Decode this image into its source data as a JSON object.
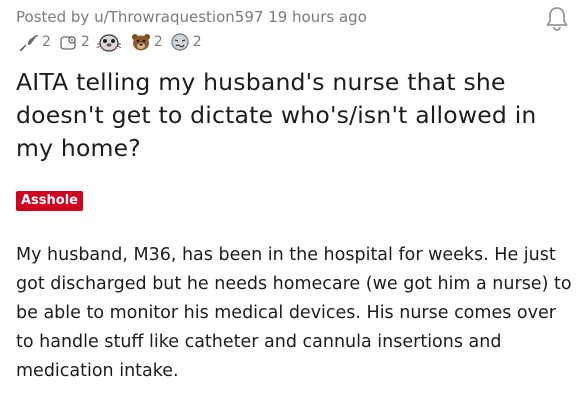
{
  "post": {
    "posted_by_prefix": "Posted by",
    "username": "u/Throwraquestion597",
    "time_ago": "19 hours ago",
    "awards": [
      {
        "icon": "rocket-icon",
        "count": "2"
      },
      {
        "icon": "toilet-paper-icon",
        "count": "2"
      },
      {
        "icon": "wholesome-seal-icon",
        "count": ""
      },
      {
        "icon": "bear-icon",
        "count": "2"
      },
      {
        "icon": "confused-face-icon",
        "count": "2"
      }
    ],
    "title": "AITA telling my husband's nurse that she doesn't get to dictate who's/isn't allowed in my home?",
    "flair": "Asshole",
    "flair_color": "#d2001f",
    "body": "My husband, M36, has been in the hospital for weeks. He just got discharged but he needs homecare (we got him a nurse) to be able to monitor his medical devices. His nurse comes over to handle stuff like catheter and cannula insertions and medication intake."
  },
  "colors": {
    "meta_text": "#787c7e",
    "title_text": "#1c1c1c"
  }
}
